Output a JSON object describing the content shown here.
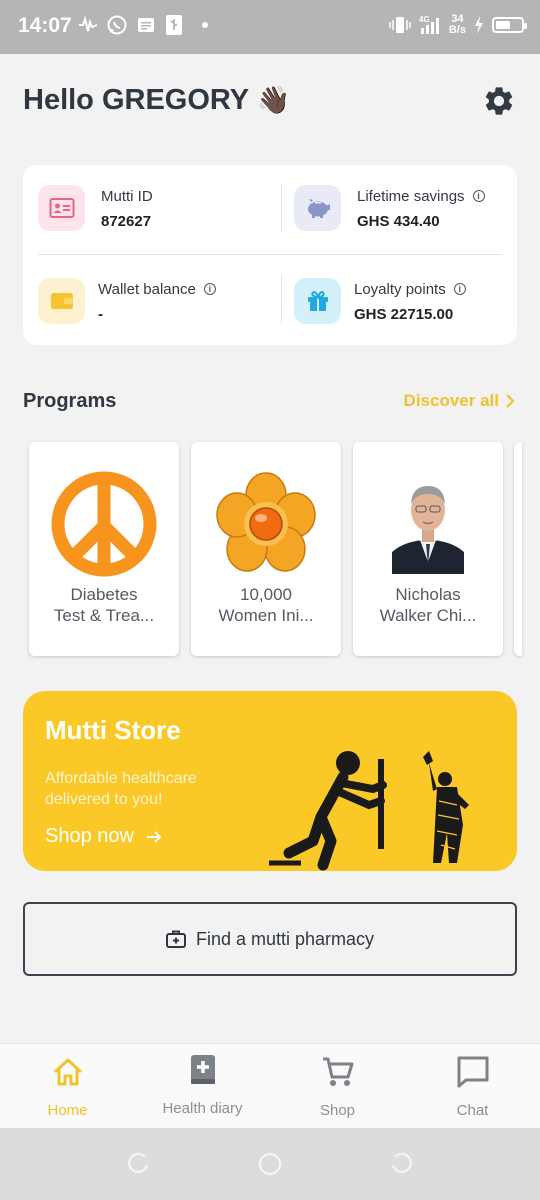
{
  "status_bar": {
    "time": "14:07",
    "network": "4G",
    "speed_value": "34",
    "speed_unit": "B/s",
    "battery_level": 0.6
  },
  "header": {
    "greeting": "Hello GREGORY",
    "greeting_emoji": "👋🏿"
  },
  "info": {
    "mutti_id": {
      "label": "Mutti ID",
      "value": "872627",
      "icon": "id-card-icon",
      "icon_bg": "#fde4ea",
      "icon_color": "#e9657f"
    },
    "lifetime_savings": {
      "label": "Lifetime savings",
      "value": "GHS 434.40",
      "icon": "piggy-bank-icon",
      "icon_bg": "#e8ebf7",
      "icon_color": "#8a96c8"
    },
    "wallet_balance": {
      "label": "Wallet balance",
      "value": "-",
      "icon": "wallet-icon",
      "icon_bg": "#fdf1cf",
      "icon_color": "#f5c42e"
    },
    "loyalty_points": {
      "label": "Loyalty points",
      "value": "GHS 22715.00",
      "icon": "gift-icon",
      "icon_bg": "#d4f0fb",
      "icon_color": "#21a9e0"
    }
  },
  "programs": {
    "title": "Programs",
    "discover_label": "Discover all",
    "items": [
      {
        "line1": "Diabetes",
        "line2": "Test & Trea...",
        "image": "peace-sign-image"
      },
      {
        "line1": "10,000",
        "line2": "Women Ini...",
        "image": "orange-flower-image"
      },
      {
        "line1": "Nicholas",
        "line2": "Walker Chi...",
        "image": "portrait-photo"
      }
    ]
  },
  "store": {
    "title": "Mutti Store",
    "subtitle": "Affordable healthcare delivered to you!",
    "cta": "Shop now"
  },
  "pharmacy": {
    "label": "Find a mutti pharmacy"
  },
  "bottom_nav": {
    "items": [
      {
        "label": "Home",
        "icon": "home-icon",
        "active": true
      },
      {
        "label": "Health diary",
        "icon": "medical-book-icon",
        "active": false
      },
      {
        "label": "Shop",
        "icon": "cart-icon",
        "active": false
      },
      {
        "label": "Chat",
        "icon": "chat-icon",
        "active": false
      }
    ]
  },
  "colors": {
    "accent": "#f2c12e",
    "store_bg": "#fbc927",
    "text_dark": "#2f3741"
  }
}
